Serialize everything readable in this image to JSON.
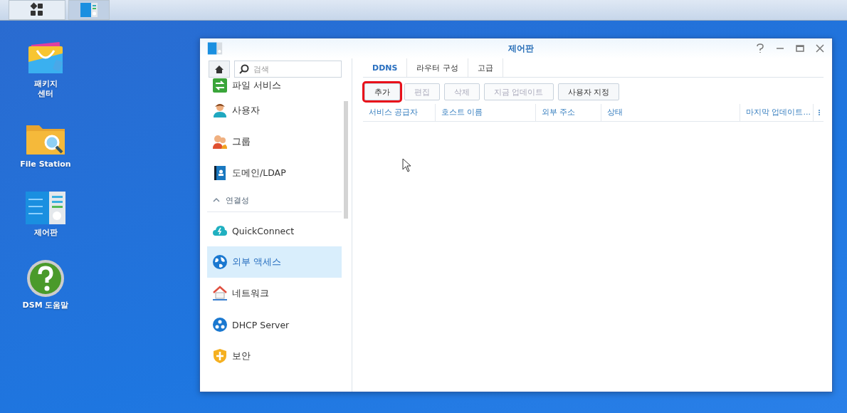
{
  "taskbar": {
    "apps": [
      {
        "selected": false
      },
      {
        "selected": true
      }
    ]
  },
  "desktop_icons": [
    {
      "label": "패키지\n센터"
    },
    {
      "label": "File Station"
    },
    {
      "label": "제어판"
    },
    {
      "label": "DSM 도움말"
    }
  ],
  "window": {
    "title": "제어판",
    "search": {
      "placeholder": "검색"
    },
    "sidebar": {
      "items": [
        {
          "kind": "item",
          "label": "파일 서비스",
          "selected": false
        },
        {
          "kind": "item",
          "label": "사용자",
          "selected": false
        },
        {
          "kind": "item",
          "label": "그룹",
          "selected": false
        },
        {
          "kind": "item",
          "label": "도메인/LDAP",
          "selected": false
        },
        {
          "kind": "header",
          "label": "연결성",
          "expanded": true
        },
        {
          "kind": "item",
          "label": "QuickConnect",
          "selected": false
        },
        {
          "kind": "item",
          "label": "외부 액세스",
          "selected": true
        },
        {
          "kind": "item",
          "label": "네트워크",
          "selected": false
        },
        {
          "kind": "item",
          "label": "DHCP Server",
          "selected": false
        },
        {
          "kind": "item",
          "label": "보안",
          "selected": false
        }
      ]
    },
    "tabs": [
      {
        "label": "DDNS",
        "selected": true
      },
      {
        "label": "라우터 구성",
        "selected": false
      },
      {
        "label": "고급",
        "selected": false
      }
    ],
    "buttons": [
      {
        "label": "추가",
        "disabled": false,
        "highlighted": true
      },
      {
        "label": "편집",
        "disabled": true,
        "highlighted": false
      },
      {
        "label": "삭제",
        "disabled": true,
        "highlighted": false
      },
      {
        "label": "지금 업데이트",
        "disabled": true,
        "highlighted": false
      },
      {
        "label": "사용자 지정",
        "disabled": false,
        "highlighted": false
      }
    ],
    "table": {
      "columns": [
        "서비스 공급자",
        "호스트 이름",
        "외부 주소",
        "상태",
        "마지막 업데이트..."
      ]
    }
  }
}
